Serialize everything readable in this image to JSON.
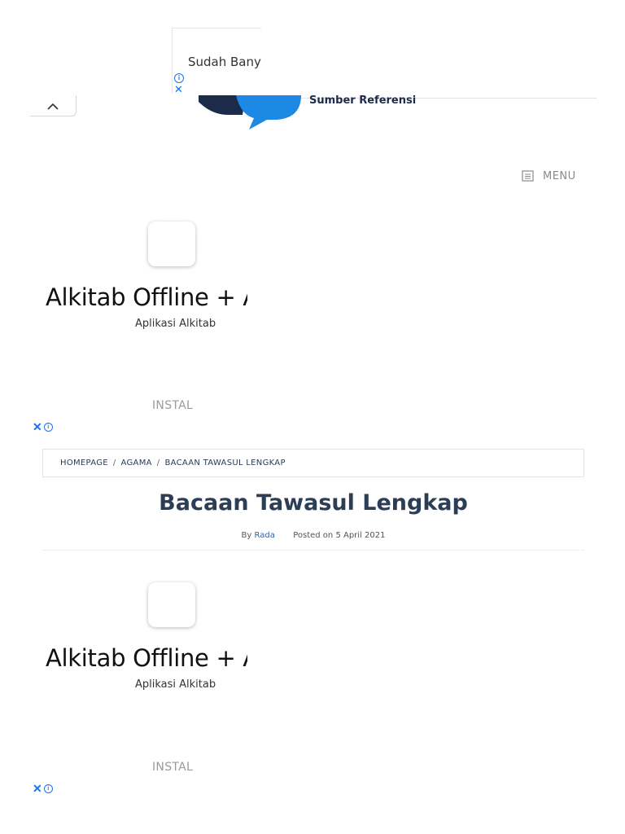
{
  "top_ad": {
    "text": "Sudah Banya",
    "info_icon": "info-icon",
    "close_icon": "close-icon"
  },
  "header": {
    "collapse_icon": "chevron-up-icon",
    "logo_tagline": "Sumber Referensi",
    "menu_icon": "menu-list-icon",
    "menu_label": "MENU"
  },
  "app_ads": [
    {
      "title": "Alkitab Offline + A",
      "subtitle": "Aplikasi Alkitab",
      "install_label": "INSTAL"
    },
    {
      "title": "Alkitab Offline + A",
      "subtitle": "Aplikasi Alkitab",
      "install_label": "INSTAL"
    }
  ],
  "breadcrumb": {
    "items": [
      "HOMEPAGE",
      "AGAMA",
      "BACAAN TAWASUL LENGKAP"
    ],
    "separator": "/"
  },
  "post": {
    "title": "Bacaan Tawasul Lengkap",
    "by_label": "By",
    "author": "Rada",
    "posted_label": "Posted on 5 April 2021"
  },
  "colors": {
    "accent_blue": "#1a73e8",
    "title_navy": "#2c3e55",
    "logo_blue": "#1e88e5",
    "logo_dark": "#1c2b4a"
  }
}
